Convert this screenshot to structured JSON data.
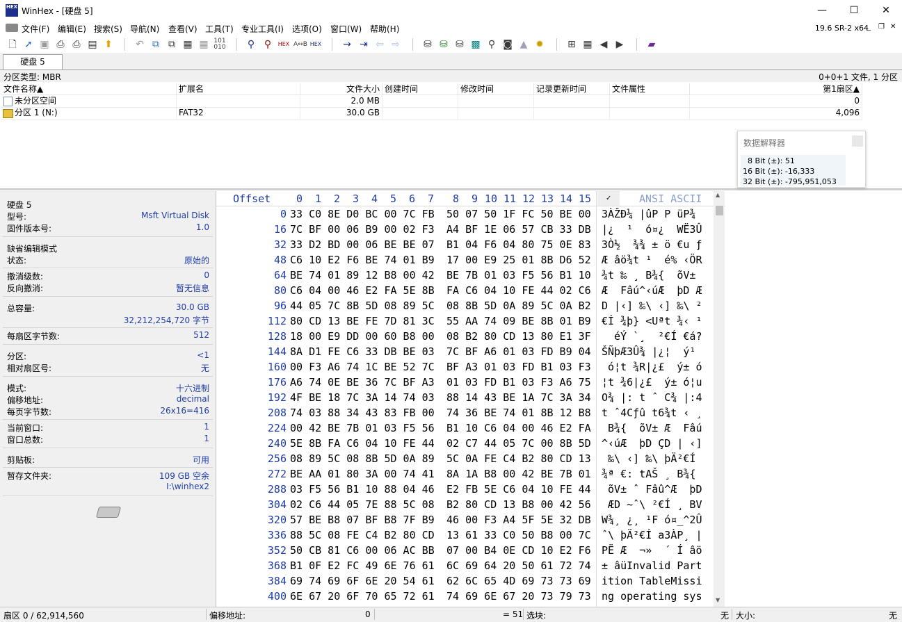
{
  "window": {
    "title": "WinHex - [硬盘 5]",
    "logo_text": "HEX",
    "minimize": "—",
    "maximize": "☐",
    "close": "✕"
  },
  "menu": [
    "文件(F)",
    "编辑(E)",
    "搜索(S)",
    "导航(N)",
    "查看(V)",
    "工具(T)",
    "专业工具(I)",
    "选项(O)",
    "窗口(W)",
    "帮助(H)"
  ],
  "version": "19.6 SR-2 x64",
  "toolbar_icons": [
    "new-file-icon",
    "open-file-icon",
    "save-icon",
    "print-icon",
    "print-preview-icon",
    "properties-icon",
    "export-icon",
    "undo-icon",
    "copy-icon",
    "copy-block-icon",
    "paste-icon",
    "paste-special-icon",
    "binary-icon",
    "find-icon",
    "find-replace-icon",
    "find-hex-icon",
    "replace-text-icon",
    "replace-hex-icon",
    "goto-offset-icon",
    "goto-sector-icon",
    "back-icon",
    "forward-icon",
    "open-disk-icon",
    "clone-disk-icon",
    "disk-tools-icon",
    "calculator-icon",
    "zoom-icon",
    "camera-icon",
    "settings-icon",
    "tree-view-icon",
    "grid-view-icon",
    "prev-icon",
    "next-icon",
    "book-icon"
  ],
  "tab": {
    "label": "硬盘 5"
  },
  "partition_bar": {
    "type_label": "分区类型: MBR",
    "summary": "0+0+1 文件, 1 分区"
  },
  "file_list": {
    "columns": [
      "文件名称▲",
      "扩展名",
      "文件大小",
      "创建时间",
      "修改时间",
      "记录更新时间",
      "文件属性",
      "第1扇区▲"
    ],
    "rows": [
      {
        "name": "未分区空间",
        "ext": "",
        "size": "2.0 MB",
        "created": "",
        "modified": "",
        "record": "",
        "attr": "",
        "first_sector": "0"
      },
      {
        "name": "分区 1 (N:)",
        "ext": "FAT32",
        "size": "30.0 GB",
        "created": "",
        "modified": "",
        "record": "",
        "attr": "",
        "first_sector": "4,096"
      }
    ]
  },
  "interpreter": {
    "title": "数据解释器",
    "rows": [
      "8 Bit (±): 51",
      "16 Bit (±): -16,333",
      "32 Bit (±): -795,951,053"
    ]
  },
  "info_panel": {
    "disk_name": "硬盘 5",
    "model_label": "型号:",
    "model_value": "Msft Virtual Disk",
    "firmware_label": "固件版本号:",
    "firmware_value": "1.0",
    "edit_mode_label": "缺省编辑模式",
    "state_label": "状态:",
    "state_value": "原始的",
    "undo_level_label": "撤消级数:",
    "undo_level_value": "0",
    "reverse_undo_label": "反向撤消:",
    "reverse_undo_value": "暂无信息",
    "capacity_label": "总容量:",
    "capacity_value": "30.0 GB",
    "capacity_bytes": "32,212,254,720 字节",
    "bytes_per_sector_label": "每扇区字节数:",
    "bytes_per_sector_value": "512",
    "partition_label": "分区:",
    "partition_value": "<1",
    "rel_sector_label": "相对扇区号:",
    "rel_sector_value": "无",
    "mode_label": "模式:",
    "mode_value": "十六进制",
    "offset_addr_label": "偏移地址:",
    "offset_addr_value": "decimal",
    "bytes_per_page_label": "每页字节数:",
    "bytes_per_page_value": "26x16=416",
    "cur_window_label": "当前窗口:",
    "cur_window_value": "1",
    "total_windows_label": "窗口总数:",
    "total_windows_value": "1",
    "clipboard_label": "剪贴板:",
    "clipboard_value": "可用",
    "temp_folder_label": "暂存文件夹:",
    "temp_folder_value": "109 GB 空余",
    "temp_folder_path": "I:\\winhex2"
  },
  "hex_view": {
    "offset_header": "Offset",
    "col_headers_1": [
      "0",
      "1",
      "2",
      "3",
      "4",
      "5",
      "6",
      "7"
    ],
    "col_headers_2": [
      "8",
      "9",
      "10",
      "11",
      "12",
      "13",
      "14",
      "15"
    ],
    "ascii_header": "ANSI ASCII",
    "rows": [
      {
        "offset": "0",
        "g1": "33 C0 8E D0 BC 00 7C FB",
        "g2": "50 07 50 1F FC 50 BE 00",
        "ascii": "3ÀŽÐ¼ |ûP P üP¾ "
      },
      {
        "offset": "16",
        "g1": "7C BF 00 06 B9 00 02 F3",
        "g2": "A4 BF 1E 06 57 CB 33 DB",
        "ascii": "|¿  ¹  ó¤¿  WË3Û"
      },
      {
        "offset": "32",
        "g1": "33 D2 BD 00 06 BE BE 07",
        "g2": "B1 04 F6 04 80 75 0E 83",
        "ascii": "3Ò½  ¾¾ ± ö €u ƒ"
      },
      {
        "offset": "48",
        "g1": "C6 10 E2 F6 BE 74 01 B9",
        "g2": "17 00 E9 25 01 8B D6 52",
        "ascii": "Æ âö¾t ¹  é% ‹ÖR"
      },
      {
        "offset": "64",
        "g1": "BE 74 01 89 12 B8 00 42",
        "g2": "BE 7B 01 03 F5 56 B1 10",
        "ascii": "¾t ‰ ¸ B¾{  õV± "
      },
      {
        "offset": "80",
        "g1": "C6 04 00 46 E2 FA 5E 8B",
        "g2": "FA C6 04 10 FE 44 02 C6",
        "ascii": "Æ  Fâú^‹úÆ  þD Æ"
      },
      {
        "offset": "96",
        "g1": "44 05 7C 8B 5D 08 89 5C",
        "g2": "08 8B 5D 0A 89 5C 0A B2",
        "ascii": "D |‹] ‰\\ ‹] ‰\\ ²"
      },
      {
        "offset": "112",
        "g1": "80 CD 13 BE FE 7D 81 3C",
        "g2": "55 AA 74 09 BE 8B 01 B9",
        "ascii": "€Í ¾þ} <Uªt ¾‹ ¹"
      },
      {
        "offset": "128",
        "g1": "18 00 E9 DD 00 60 B8 00",
        "g2": "08 B2 80 CD 13 80 E1 3F",
        "ascii": "  éÝ `¸  ²€Í €á?"
      },
      {
        "offset": "144",
        "g1": "8A D1 FE C6 33 DB BE 03",
        "g2": "7C BF A6 01 03 FD B9 04",
        "ascii": "ŠÑþÆ3Û¾ |¿¦  ý¹ "
      },
      {
        "offset": "160",
        "g1": "00 F3 A6 74 1C BE 52 7C",
        "g2": "BF A3 01 03 FD B1 03 F3",
        "ascii": " ó¦t ¾R|¿£  ý± ó"
      },
      {
        "offset": "176",
        "g1": "A6 74 0E BE 36 7C BF A3",
        "g2": "01 03 FD B1 03 F3 A6 75",
        "ascii": "¦t ¾6|¿£  ý± ó¦u"
      },
      {
        "offset": "192",
        "g1": "4F BE 18 7C 3A 14 74 03",
        "g2": "88 14 43 BE 1A 7C 3A 34",
        "ascii": "O¾ |: t ˆ C¾ |:4"
      },
      {
        "offset": "208",
        "g1": "74 03 88 34 43 83 FB 00",
        "g2": "74 36 BE 74 01 8B 12 B8",
        "ascii": "t ˆ4Cƒû t6¾t ‹ ¸"
      },
      {
        "offset": "224",
        "g1": "00 42 BE 7B 01 03 F5 56",
        "g2": "B1 10 C6 04 00 46 E2 FA",
        "ascii": " B¾{  õV± Æ  Fâú"
      },
      {
        "offset": "240",
        "g1": "5E 8B FA C6 04 10 FE 44",
        "g2": "02 C7 44 05 7C 00 8B 5D",
        "ascii": "^‹úÆ  þD ÇD | ‹]"
      },
      {
        "offset": "256",
        "g1": "08 89 5C 08 8B 5D 0A 89",
        "g2": "5C 0A FE C4 B2 80 CD 13",
        "ascii": " ‰\\ ‹] ‰\\ þÄ²€Í "
      },
      {
        "offset": "272",
        "g1": "BE AA 01 80 3A 00 74 41",
        "g2": "8A 1A B8 00 42 BE 7B 01",
        "ascii": "¾ª €: tAŠ ¸ B¾{ "
      },
      {
        "offset": "288",
        "g1": "03 F5 56 B1 10 88 04 46",
        "g2": "E2 FB 5E C6 04 10 FE 44",
        "ascii": " õV± ˆ Fâû^Æ  þD"
      },
      {
        "offset": "304",
        "g1": "02 C6 44 05 7E 88 5C 08",
        "g2": "B2 80 CD 13 B8 00 42 56",
        "ascii": " ÆD ~ˆ\\ ²€Í ¸ BV"
      },
      {
        "offset": "320",
        "g1": "57 BE B8 07 BF B8 7F B9",
        "g2": "46 00 F3 A4 5F 5E 32 DB",
        "ascii": "W¾¸ ¿¸ ¹F ó¤_^2Û"
      },
      {
        "offset": "336",
        "g1": "88 5C 08 FE C4 B2 80 CD",
        "g2": "13 61 33 C0 50 B8 00 7C",
        "ascii": "ˆ\\ þÄ²€Í a3ÀP¸ |"
      },
      {
        "offset": "352",
        "g1": "50 CB 81 C6 00 06 AC BB",
        "g2": "07 00 B4 0E CD 10 E2 F6",
        "ascii": "PË Æ  ¬»  ´ Í âö"
      },
      {
        "offset": "368",
        "g1": "B1 0F E2 FC 49 6E 76 61",
        "g2": "6C 69 64 20 50 61 72 74",
        "ascii": "± âüInvalid Part"
      },
      {
        "offset": "384",
        "g1": "69 74 69 6F 6E 20 54 61",
        "g2": "62 6C 65 4D 69 73 73 69",
        "ascii": "ition TableMissi"
      },
      {
        "offset": "400",
        "g1": "6E 67 20 6F 70 65 72 61",
        "g2": "74 69 6E 67 20 73 79 73",
        "ascii": "ng operating sys"
      }
    ]
  },
  "status_bar": {
    "sector": "扇区 0 / 62,914,560",
    "offset_label": "偏移地址:",
    "offset_value": "0",
    "value": "= 51",
    "block_label": "选块:",
    "block_value": "无",
    "size_label": "大小:",
    "size_value": "无"
  }
}
